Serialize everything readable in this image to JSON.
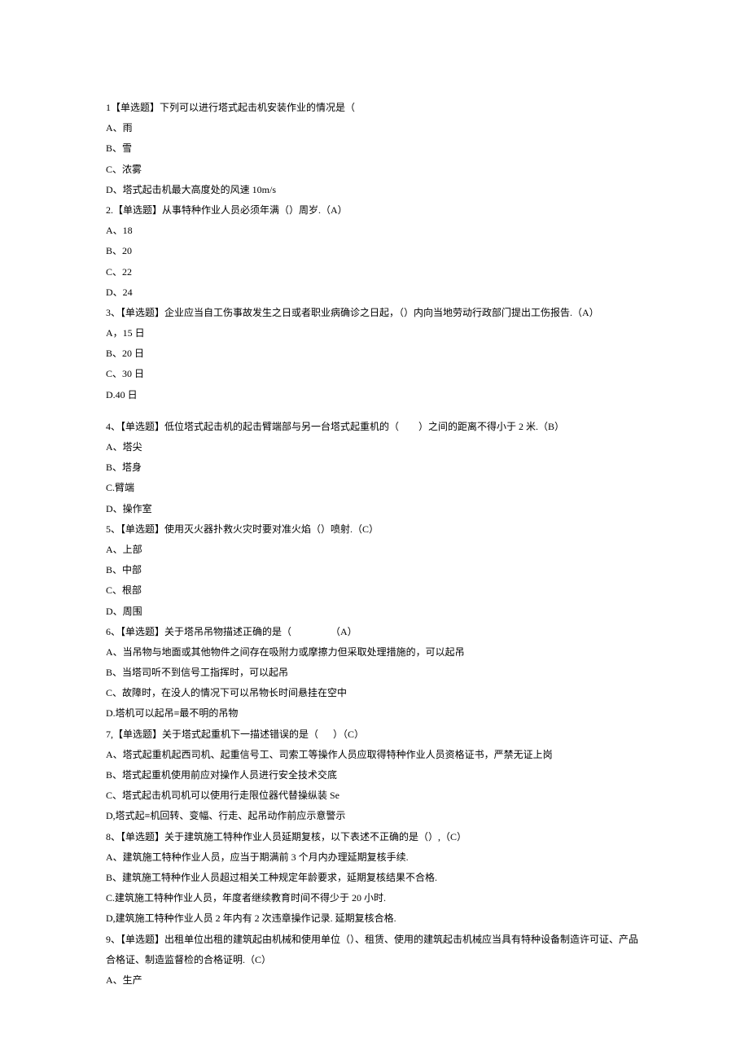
{
  "lines": [
    "1【单选题】下列可以进行塔式起击机安装作业的情况是（",
    "A、雨",
    "B、雪",
    "C、浓雾",
    "D、塔式起击机最大高度处的风速 10m/s",
    "2.【单选题】从事特种作业人员必须年满（）周岁.（A）",
    "A、18",
    "B、20",
    "C、22",
    "D、24",
    "3、【单选题】企业应当自工伤事故发生之日或者职业病确诊之日起，（）内向当地劳动行政部门提出工伤报告.（A）",
    "A，15 日",
    "B、20 日",
    "C、30 日",
    "D.40 日",
    "",
    "4、【单选题】低位塔式起击机的起击臂端部与另一台塔式起重机的（        ）之间的距离不得小于 2 米.（B）",
    "A、塔尖",
    "B、塔身",
    "C.臂端",
    "D、操作室",
    "5、【单选题】使用灭火器扑救火灾时要对准火焰（）喷射.（C）",
    "A、上部",
    "B、中部",
    "C、根部",
    "D、周围",
    "6、【单选题】关于塔吊吊物描述正确的是（                （A）",
    "A、当吊物与地面或其他物件之间存在吸附力或摩擦力但采取处理措施的，可以起吊",
    "B、当塔司听不到信号工指挥时，可以起吊",
    "C、故障时，在没人的情况下可以吊物长时间悬挂在空中",
    "D.塔机可以起吊≡最不明的吊物",
    "7,【单选题】关于塔式起重机下一描述错误的是（      ）（C）",
    "A、塔式起重机起西司机、起重信号工、司索工等操作人员应取得特种作业人员资格证书，严禁无证上岗",
    "B、塔式起重机使用前应对操作人员进行安全技术交底",
    "C、塔式起击机司机可以使用行走限位器代替操纵装 Se",
    "D,塔式起≡机回转、变幅、行走、起吊动作前应示意警示",
    "8、【单选题】关于建筑施工特种作业人员延期复核，以下表述不正确的是（）,（C）",
    "A、建筑施工特种作业人员，应当于期满前 3 个月内办理延期复核手续.",
    "B、建筑施工特种作业人员超过相关工种规定年龄要求，延期复核结果不合格.",
    "C.建筑施工特种作业人员，年度者继续教育时间不得少于 20 小时.",
    "D,建筑施工特种作业人员 2 年内有 2 次违章操作记录. 延期复核合格.",
    "9、【单选题】出租单位出租的建筑起由机械和使用单位（）、租赁、使用的建筑起击机械应当具有特种设备制造许可证、产品合格证、制造监督检的合格证明.（C）",
    "A、生产"
  ]
}
